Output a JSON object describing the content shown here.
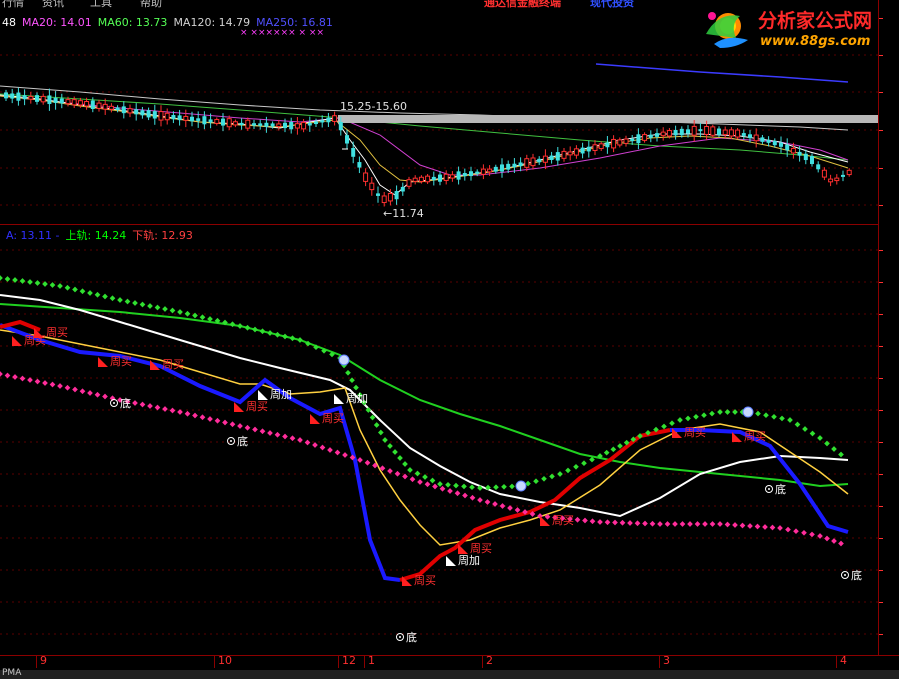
{
  "menu": {
    "items": [
      "行情",
      "资讯",
      "工具",
      "帮助"
    ]
  },
  "ad": {
    "left": "通达信金融终端",
    "right": "现代投资"
  },
  "logo": {
    "title": "分析家公式网",
    "url": "www.88gs.com"
  },
  "top_panel": {
    "ma_labels": [
      {
        "text": "48",
        "color": "#ffffff"
      },
      {
        "text": "MA20: 14.01",
        "color": "#ff55ff"
      },
      {
        "text": "MA60: 13.73",
        "color": "#55ff55"
      },
      {
        "text": "MA120: 14.79",
        "color": "#d0d0d0"
      },
      {
        "text": "MA250: 16.81",
        "color": "#5050ff"
      }
    ],
    "markers": "×    ××××××    ×    ××",
    "annotation_high": "15.25-15.60",
    "annotation_low": "←11.74"
  },
  "bottom_panel": {
    "labels": [
      {
        "text": "A: 13.11  -",
        "color": "#3030ff"
      },
      {
        "text": "上轨: 14.24",
        "color": "#00ff00"
      },
      {
        "text": "下轨: 12.93",
        "color": "#ff4040"
      }
    ],
    "signals": {
      "buy": "周买",
      "add": "周加",
      "bottom": "底"
    }
  },
  "x_axis": {
    "labels": [
      "9",
      "10",
      "12",
      "1",
      "2",
      "3",
      "4"
    ]
  },
  "status_bar": {
    "label": "PMA"
  },
  "colors": {
    "background": "#000000",
    "axis": "#8b0000",
    "upper_band": "#00e000",
    "lower_band": "#ff2d9b",
    "white_line": "#ffffff",
    "yellow_line": "#ffd040",
    "blue_line": "#1a1aff",
    "red_line": "#e00000"
  }
}
